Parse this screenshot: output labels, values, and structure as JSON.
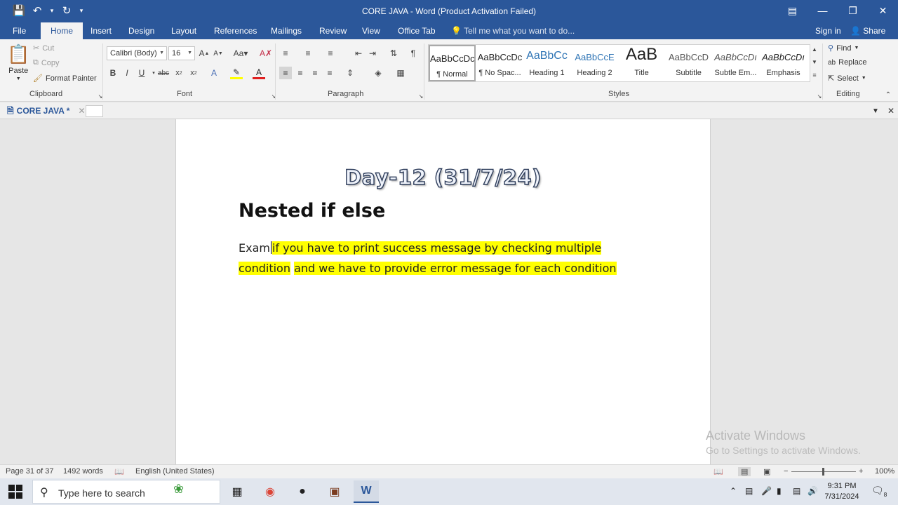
{
  "window": {
    "title": "CORE JAVA - Word (Product Activation Failed)",
    "controls": [
      "restore-ribbon",
      "minimize",
      "maximize",
      "close"
    ]
  },
  "ribbon_tabs": [
    "File",
    "Home",
    "Insert",
    "Design",
    "Layout",
    "References",
    "Mailings",
    "Review",
    "View",
    "Office Tab"
  ],
  "tell_me": "Tell me what you want to do...",
  "sign_in": "Sign in",
  "share": "Share",
  "clipboard": {
    "paste": "Paste",
    "cut": "Cut",
    "copy": "Copy",
    "format_painter": "Format Painter",
    "label": "Clipboard"
  },
  "font": {
    "name": "Calibri (Body)",
    "size": "16",
    "label": "Font"
  },
  "paragraph": {
    "label": "Paragraph"
  },
  "styles": {
    "label": "Styles",
    "items": [
      {
        "preview": "AaBbCcDc",
        "name": "¶ Normal"
      },
      {
        "preview": "AaBbCcDc",
        "name": "¶ No Spac..."
      },
      {
        "preview": "AaBbCc",
        "name": "Heading 1"
      },
      {
        "preview": "AaBbCcE",
        "name": "Heading 2"
      },
      {
        "preview": "AaB",
        "name": "Title"
      },
      {
        "preview": "AaBbCcD",
        "name": "Subtitle"
      },
      {
        "preview": "AaBbCcDı",
        "name": "Subtle Em..."
      },
      {
        "preview": "AaBbCcDı",
        "name": "Emphasis"
      }
    ]
  },
  "editing": {
    "find": "Find",
    "replace": "Replace",
    "select": "Select",
    "label": "Editing"
  },
  "doc_tab": {
    "name": "CORE JAVA *"
  },
  "document": {
    "title": "Day-12 (31/7/24)",
    "heading": "Nested if else",
    "line1_plain": "Exam",
    "line1_highlight": "if you have to print success message by checking multiple",
    "line2_highlight_a": "condition",
    "line2_highlight_b": "and we have to provide error message for each condition"
  },
  "watermark": {
    "line1": "Activate Windows",
    "line2": "Go to Settings to activate Windows."
  },
  "status": {
    "page": "Page 31 of 37",
    "words": "1492 words",
    "language": "English (United States)",
    "zoom": "100%"
  },
  "taskbar": {
    "search_placeholder": "Type here to search",
    "time": "9:31 PM",
    "date": "7/31/2024",
    "notifications": "8"
  },
  "colors": {
    "word_blue": "#2b579a",
    "highlight": "#ffff00"
  }
}
